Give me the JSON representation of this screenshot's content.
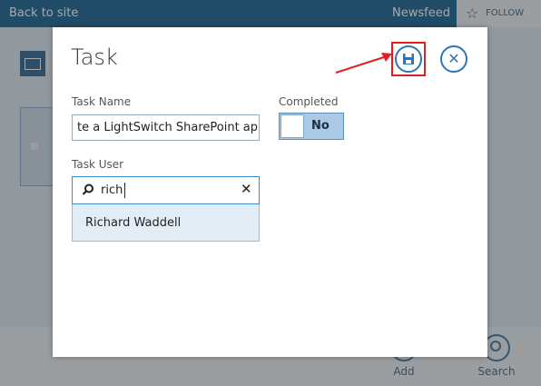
{
  "topbar": {
    "back_label": "Back to site",
    "newsfeed_label": "Newsfeed",
    "follow_label": "FOLLOW"
  },
  "bottom_bar": {
    "add_label": "Add",
    "search_label": "Search"
  },
  "dialog": {
    "title": "Task",
    "task_name": {
      "label": "Task Name",
      "value": "te a LightSwitch SharePoint app"
    },
    "completed": {
      "label": "Completed",
      "value": "No"
    },
    "task_user": {
      "label": "Task User",
      "search_value": "rich",
      "suggestions": [
        {
          "name": "Richard Waddell"
        }
      ]
    }
  },
  "icons": {
    "save": "save-icon",
    "close": "close-icon",
    "search": "search-icon",
    "clear": "clear-icon",
    "star": "star-icon"
  },
  "colors": {
    "accent": "#2c76b6",
    "topbar": "#0c5a8a",
    "highlight": "#e02020"
  }
}
